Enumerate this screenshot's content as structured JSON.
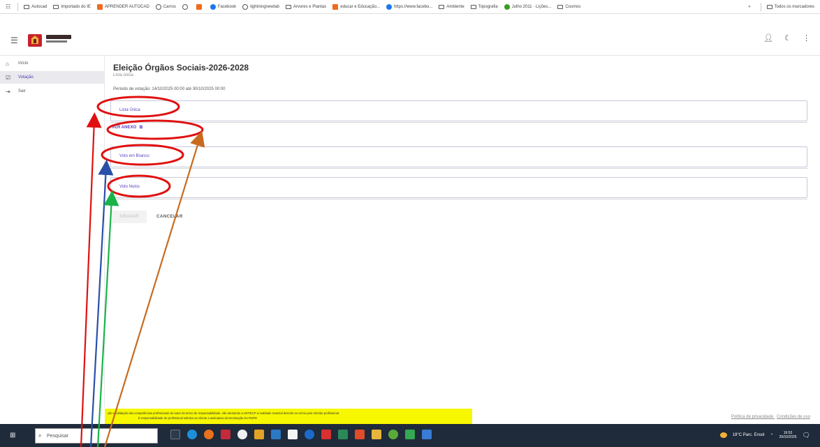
{
  "bookmarks": {
    "apps_icon": "apps-grid-icon",
    "items": [
      {
        "label": "Autocad",
        "icon": "folder"
      },
      {
        "label": "Importado do IE",
        "icon": "folder"
      },
      {
        "label": "APRENDER AUTOCAD",
        "icon": "orange"
      },
      {
        "label": "Carros",
        "icon": "globe"
      },
      {
        "label": "",
        "icon": "globe"
      },
      {
        "label": "",
        "icon": "orange"
      },
      {
        "label": "Facebook",
        "icon": "fb"
      },
      {
        "label": "lightningnewtab",
        "icon": "globe"
      },
      {
        "label": "Arvores e Plantas",
        "icon": "folder"
      },
      {
        "label": "educar e Educação...",
        "icon": "orange"
      },
      {
        "label": "https://www.facebo...",
        "icon": "fb"
      },
      {
        "label": "Ambiente",
        "icon": "folder"
      },
      {
        "label": "Topografia",
        "icon": "folder"
      },
      {
        "label": "Julho 2011 · Lições...",
        "icon": "green"
      },
      {
        "label": "Cosmos",
        "icon": "folder"
      }
    ],
    "more": "»",
    "all_bookmarks": "Todos os marcadores"
  },
  "sidebar": {
    "items": [
      {
        "label": "Início",
        "icon": "home-icon"
      },
      {
        "label": "Votação",
        "icon": "checkbox-icon"
      },
      {
        "label": "Sair",
        "icon": "logout-icon"
      }
    ]
  },
  "main": {
    "title": "Eleição Órgãos Sociais-2026-2028",
    "subtitle": "Lista única",
    "period": "Período de votação: 14/10/2025 00:00 até 30/10/2025 00:00",
    "options": [
      {
        "label": "Lista Única"
      },
      {
        "label": "Voto em Branco"
      },
      {
        "label": "Voto Nulos"
      }
    ],
    "annex_label": "VER ANEXO",
    "save_label": "GRAVAR",
    "cancel_label": "CANCELAR"
  },
  "footer": {
    "line1": "ção e validação das competências profissionais do autor do termo de responsabilidade, não atestando a ANTIECP a realidade material descrita no termo pelo referido profissional.",
    "line2": "É responsabilidade do profissional solicitar ao cliente a assinatura da Declaração Do RGPD",
    "privacy": "Política de privacidade",
    "terms": "Condições de uso"
  },
  "taskbar": {
    "search_placeholder": "Pesquisar",
    "weather": "18°C  Parc. Ensol",
    "time": "16:53",
    "date": "29/10/2025"
  },
  "colors": {
    "accent": "#5a3fc0",
    "footer_highlight": "#f7f700",
    "annotation_red": "#e01010",
    "annotation_blue": "#2a4fa8",
    "annotation_green": "#19b34a",
    "annotation_orange": "#c86a1e"
  }
}
